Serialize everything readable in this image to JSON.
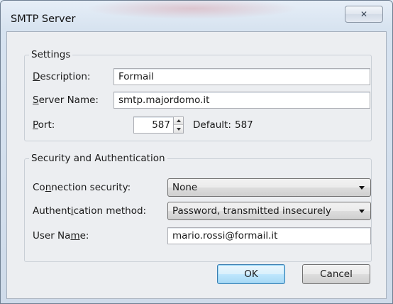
{
  "window": {
    "title": "SMTP Server",
    "close_glyph": "✕"
  },
  "settings": {
    "legend": "Settings",
    "description": {
      "label_pre": "",
      "label_ul": "D",
      "label_post": "escription:",
      "value": "Formail"
    },
    "server_name": {
      "label_pre": "",
      "label_ul": "S",
      "label_post": "erver Name:",
      "value": "smtp.majordomo.it"
    },
    "port": {
      "label_pre": "",
      "label_ul": "P",
      "label_post": "ort:",
      "value": "587",
      "default_label": "Default:",
      "default_value": "587"
    }
  },
  "security": {
    "legend": "Security and Authentication",
    "connection": {
      "label_pre": "Co",
      "label_ul": "n",
      "label_post": "nection security:",
      "selected": "None"
    },
    "auth": {
      "label_pre": "Authent",
      "label_ul": "i",
      "label_post": "cation method:",
      "selected": "Password, transmitted insecurely"
    },
    "username": {
      "label_pre": "User Na",
      "label_ul": "m",
      "label_post": "e:",
      "value": "mario.rossi@formail.it"
    }
  },
  "buttons": {
    "ok": "OK",
    "cancel": "Cancel"
  }
}
